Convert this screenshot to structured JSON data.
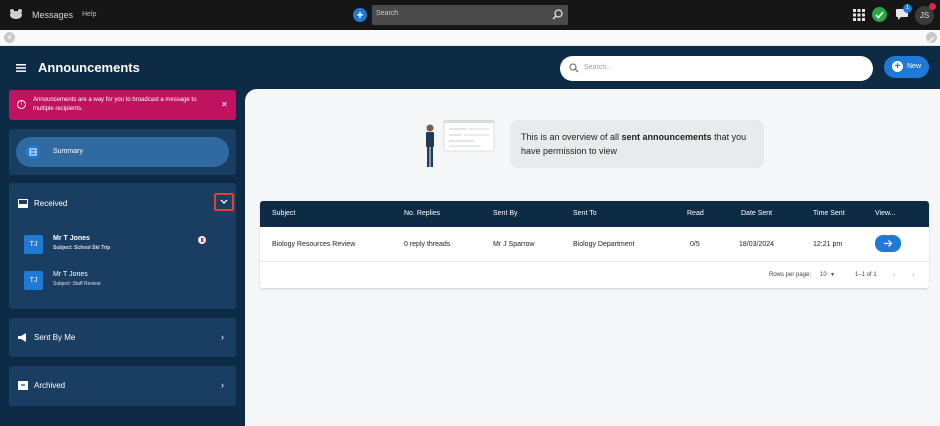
{
  "topbar": {
    "app_name": "Messages",
    "help": "Help",
    "search_placeholder": "Search",
    "notification_count": "1",
    "user_initials": "JS"
  },
  "header": {
    "title": "Announcements",
    "search_placeholder": "Search...",
    "new_label": "New"
  },
  "sidebar": {
    "alert_text": "Announcements are a way for you to broadcast a message to multiple recipients.",
    "summary_label": "Summary",
    "received_label": "Received",
    "received_items": [
      {
        "initials": "TJ",
        "name": "Mr T Jones",
        "subject": "Subject: School Ski Trip"
      },
      {
        "initials": "TJ",
        "name": "Mr T Jones",
        "subject": "Subject: Staff Review"
      }
    ],
    "sent_label": "Sent By Me",
    "archived_label": "Archived"
  },
  "main": {
    "overview_pre": "This is an overview of all ",
    "overview_bold": "sent announcements",
    "overview_post": " that you have permission to view",
    "table": {
      "headers": [
        "Subject",
        "No. Replies",
        "Sent By",
        "Sent To",
        "Read",
        "Date Sent",
        "Time Sent",
        "View..."
      ],
      "rows": [
        {
          "subject": "Biology Resources Review",
          "replies": "0 reply threads",
          "sent_by": "Mr J Sparrow",
          "sent_to": "Biology Department",
          "read": "0/5",
          "date": "18/03/2024",
          "time": "12:21 pm"
        }
      ],
      "rows_per_page_label": "Rows per page:",
      "rows_per_page": "10",
      "range": "1–1 of 1"
    }
  },
  "colors": {
    "navy": "#0d2b45",
    "panel": "#1a3e61",
    "accent": "#1e7ad6",
    "alert": "#c0125f",
    "highlight": "#e3402e"
  }
}
